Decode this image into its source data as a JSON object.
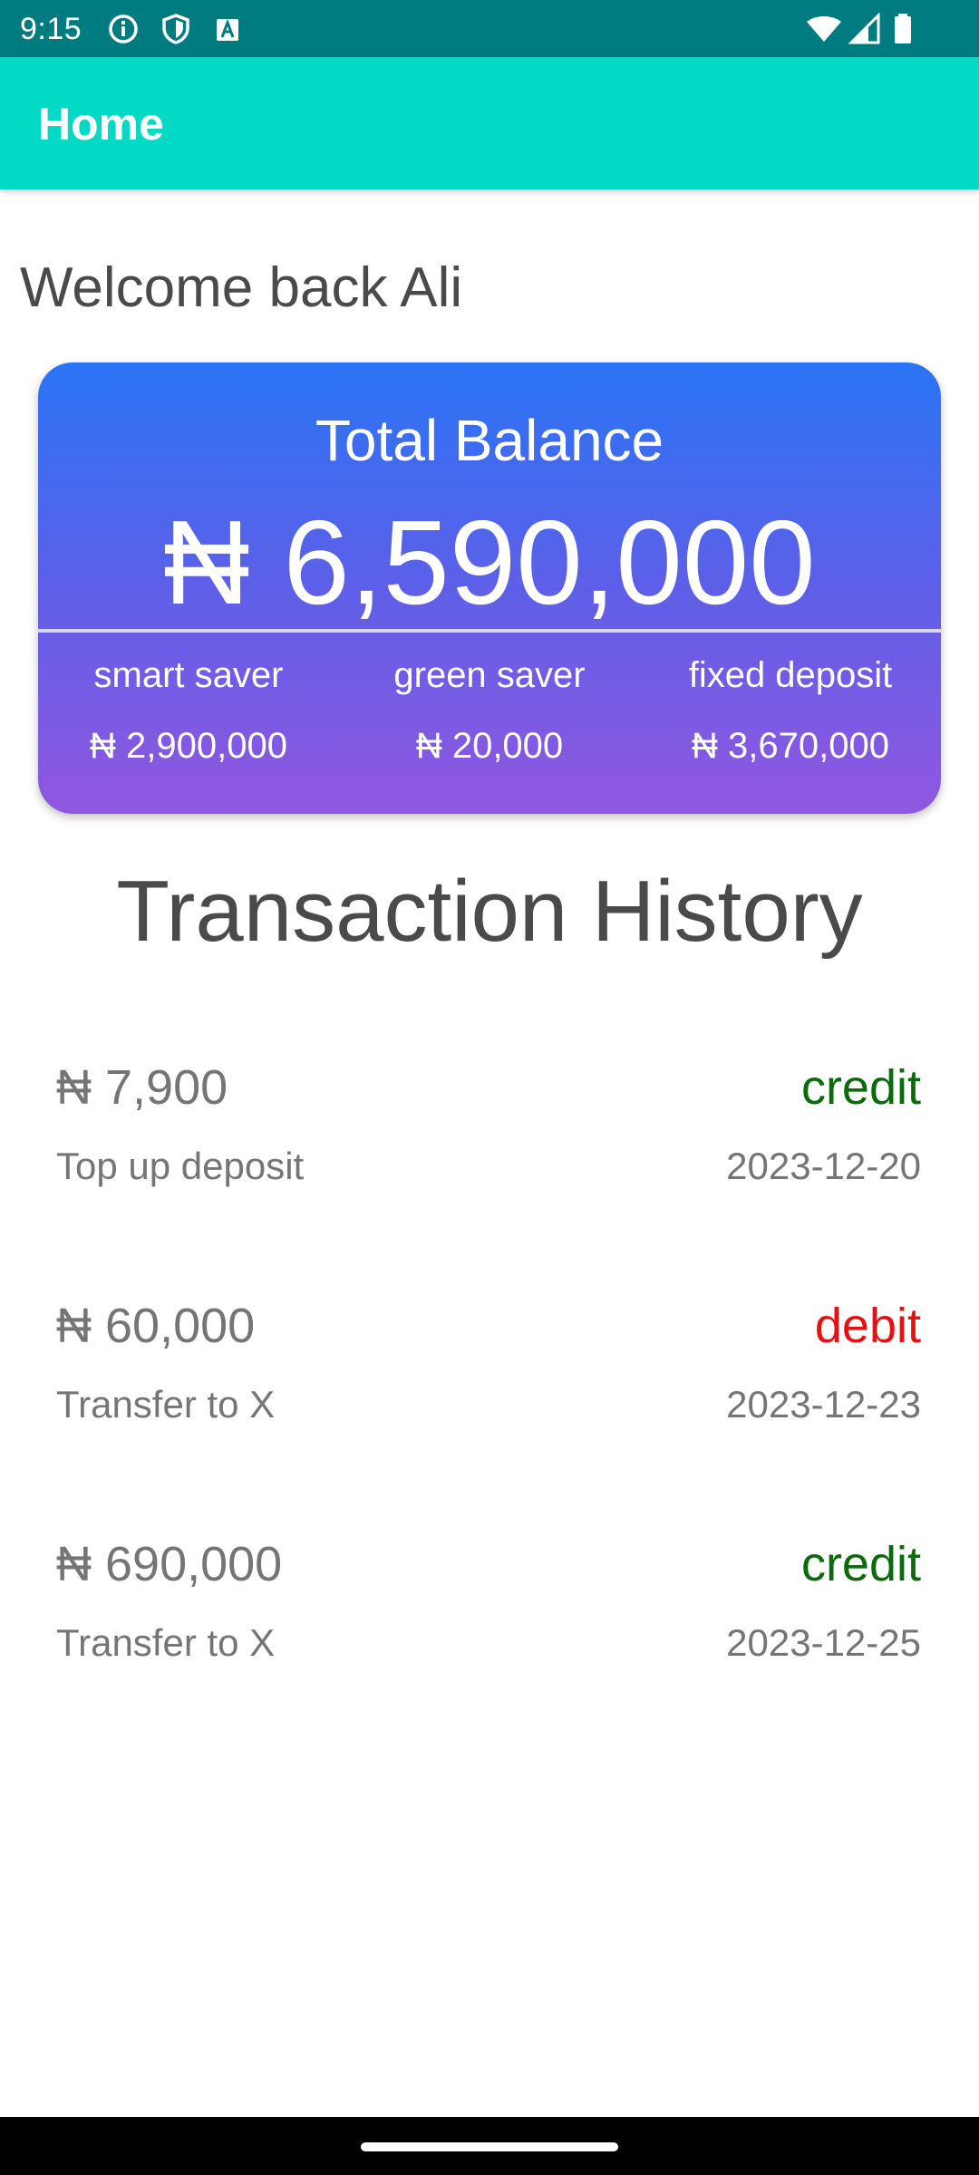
{
  "status_bar": {
    "time": "9:15",
    "left_icons": [
      "info-icon",
      "shield-icon",
      "font-a-icon"
    ],
    "right_icons": [
      "wifi-icon",
      "signal-icon",
      "battery-icon"
    ]
  },
  "app_bar": {
    "title": "Home",
    "color": "#03dac5"
  },
  "welcome": "Welcome back Ali",
  "balance_card": {
    "label": "Total Balance",
    "amount": "₦ 6,590,000",
    "accounts": [
      {
        "name": "smart saver",
        "value": "₦ 2,900,000"
      },
      {
        "name": "green saver",
        "value": "₦ 20,000"
      },
      {
        "name": "fixed deposit",
        "value": "₦ 3,670,000"
      }
    ],
    "gradient": [
      "#2a74f5",
      "#9157e0"
    ]
  },
  "history": {
    "title": "Transaction History",
    "transactions": [
      {
        "amount": "₦ 7,900",
        "type": "credit",
        "description": "Top up deposit",
        "date": "2023-12-20"
      },
      {
        "amount": "₦ 60,000",
        "type": "debit",
        "description": "Transfer to X",
        "date": "2023-12-23"
      },
      {
        "amount": "₦ 690,000",
        "type": "credit",
        "description": "Transfer to X",
        "date": "2023-12-25"
      }
    ]
  },
  "colors": {
    "credit": "#0a6b0a",
    "debit": "#e81010"
  }
}
